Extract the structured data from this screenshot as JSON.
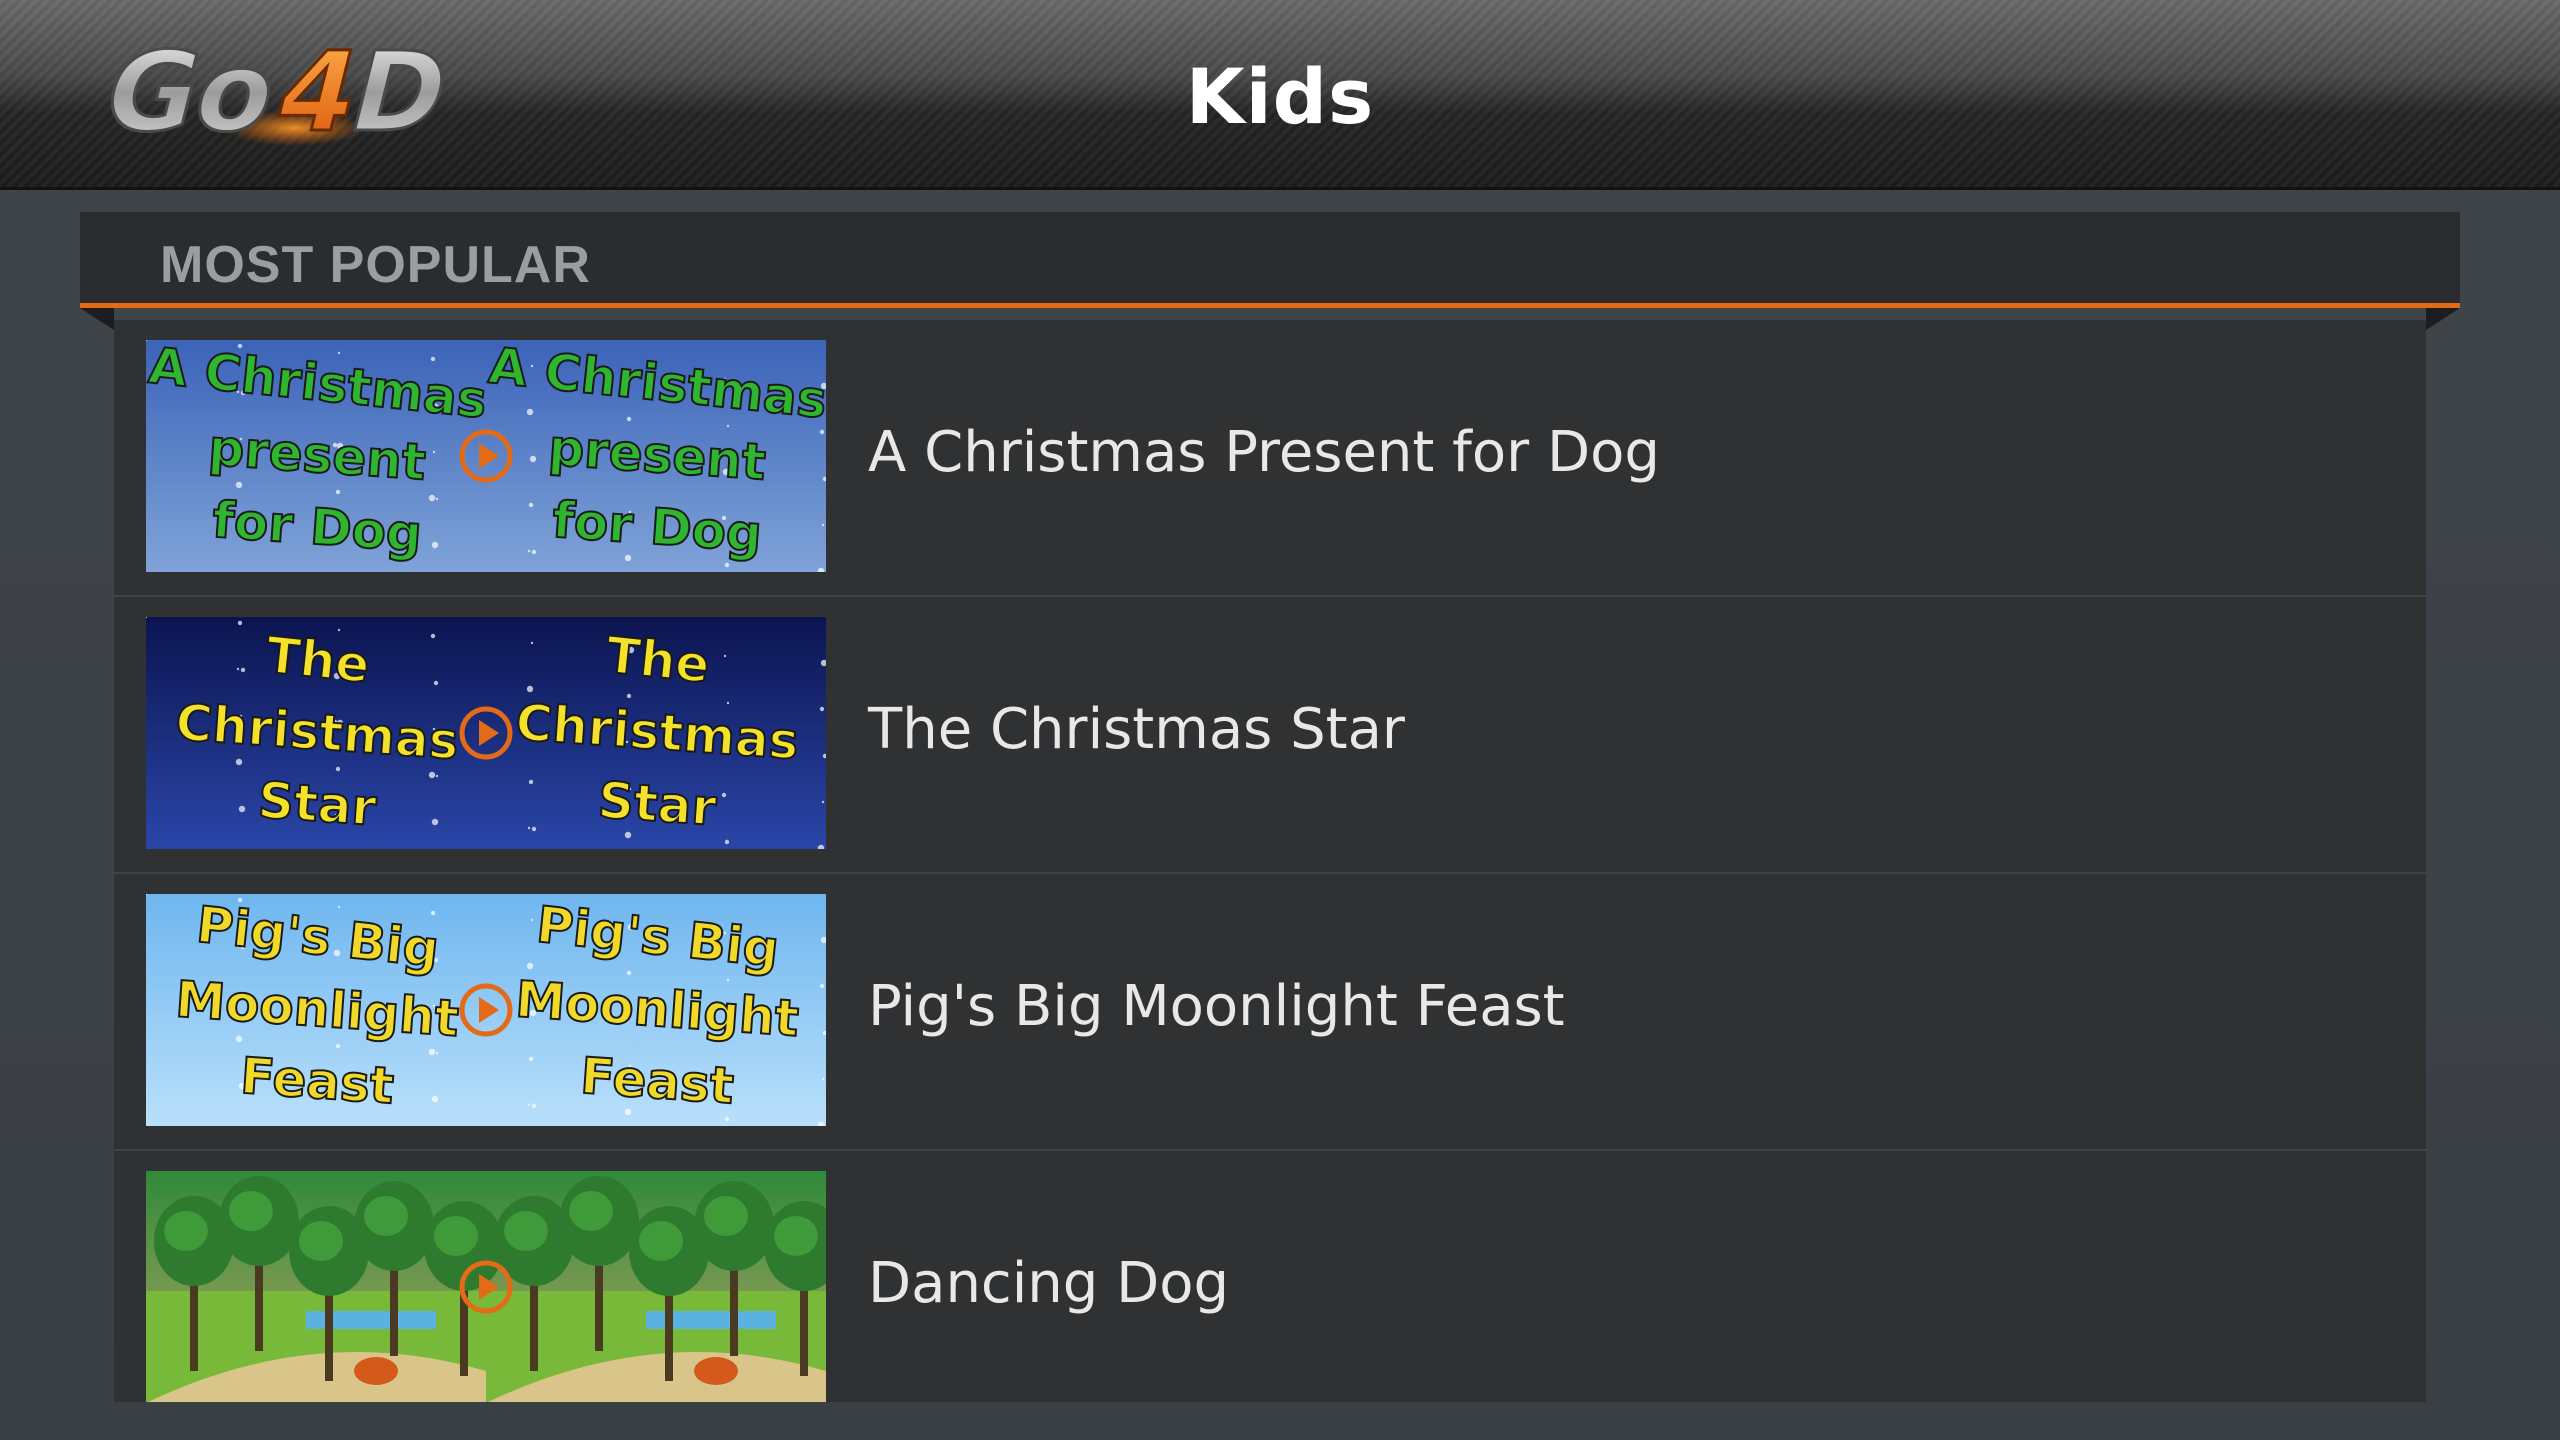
{
  "header": {
    "logo_text": "Go4D",
    "title": "Kids"
  },
  "section": {
    "title": "MOST POPULAR"
  },
  "items": [
    {
      "title": "A Christmas Present for Dog",
      "thumb_lines": [
        "A Christmas",
        "present",
        "for Dog"
      ],
      "thumb_bg_top": "#3b63b8",
      "thumb_bg_bottom": "#7fa3d8",
      "thumb_text_color": "#2fb52f",
      "thumb_icon": "play-circle-icon"
    },
    {
      "title": "The Christmas Star",
      "thumb_lines": [
        "The",
        "Christmas",
        "Star"
      ],
      "thumb_bg_top": "#0b1450",
      "thumb_bg_bottom": "#2a46a8",
      "thumb_text_color": "#f3e12a",
      "thumb_icon": "play-circle-icon"
    },
    {
      "title": "Pig's Big Moonlight Feast",
      "thumb_lines": [
        "Pig's Big",
        "Moonlight",
        "Feast"
      ],
      "thumb_bg_top": "#6fb6ef",
      "thumb_bg_bottom": "#b9e0fb",
      "thumb_text_color": "#f1d92a",
      "thumb_icon": "play-circle-icon"
    },
    {
      "title": "Dancing Dog",
      "thumb_lines": [],
      "thumb_bg_top": "#2f8a3a",
      "thumb_bg_bottom": "#b9a565",
      "thumb_text_color": "#ffffff",
      "thumb_icon": "play-circle-icon"
    }
  ],
  "colors": {
    "accent": "#e36a17",
    "panel": "#2f3133"
  }
}
